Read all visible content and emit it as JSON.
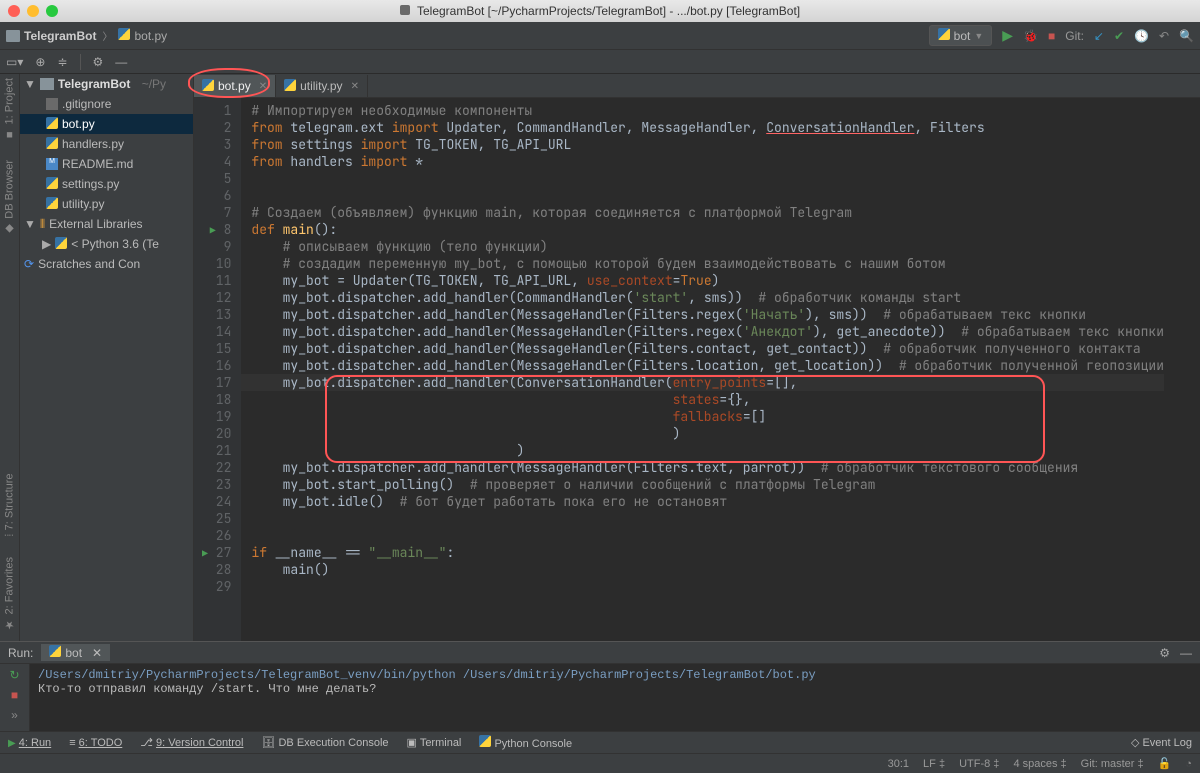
{
  "title": "TelegramBot [~/PycharmProjects/TelegramBot] - .../bot.py [TelegramBot]",
  "breadcrumbs": {
    "project": "TelegramBot",
    "file": "bot.py"
  },
  "run_config": {
    "name": "bot"
  },
  "git_label": "Git:",
  "tree": {
    "root": "TelegramBot",
    "root_path": "~/Py",
    "files": [
      ".gitignore",
      "bot.py",
      "handlers.py",
      "README.md",
      "settings.py",
      "utility.py"
    ],
    "selected": "bot.py",
    "ext_lib": "External Libraries",
    "python": "< Python 3.6 (Te",
    "scratches": "Scratches and Con"
  },
  "tabs": [
    {
      "name": "bot.py",
      "active": true
    },
    {
      "name": "utility.py",
      "active": false
    }
  ],
  "code": [
    {
      "n": 1,
      "t": "comment",
      "txt": "# Импортируем необходимые компоненты"
    },
    {
      "n": 2,
      "t": "import",
      "txt": "from telegram.ext import Updater, CommandHandler, MessageHandler, ConversationHandler, Filters",
      "red": "ConversationHandler"
    },
    {
      "n": 3,
      "t": "import",
      "txt": "from settings import TG_TOKEN, TG_API_URL"
    },
    {
      "n": 4,
      "t": "import",
      "txt": "from handlers import *"
    },
    {
      "n": 5,
      "t": "blank",
      "txt": ""
    },
    {
      "n": 6,
      "t": "blank",
      "txt": ""
    },
    {
      "n": 7,
      "t": "comment",
      "txt": "# Создаем (объявляем) функцию main, которая соединяется с платформой Telegram"
    },
    {
      "n": 8,
      "t": "def",
      "txt": "def main():"
    },
    {
      "n": 9,
      "t": "comment2",
      "txt": "    # описываем функцию (тело функции)"
    },
    {
      "n": 10,
      "t": "comment2",
      "txt": "    # создадим переменную my_bot, с помощью которой будем взаимодействовать с нашим ботом"
    },
    {
      "n": 11,
      "t": "code",
      "txt": "    my_bot = Updater(TG_TOKEN, TG_API_URL, use_context=True)"
    },
    {
      "n": 12,
      "t": "codec",
      "txt": "    my_bot.dispatcher.add_handler(CommandHandler('start', sms))  # обработчик команды start"
    },
    {
      "n": 13,
      "t": "codec",
      "txt": "    my_bot.dispatcher.add_handler(MessageHandler(Filters.regex('Начать'), sms))  # обрабатываем текс кнопки"
    },
    {
      "n": 14,
      "t": "codec",
      "txt": "    my_bot.dispatcher.add_handler(MessageHandler(Filters.regex('Анекдот'), get_anecdote))  # обрабатываем текс кнопки"
    },
    {
      "n": 15,
      "t": "codec",
      "txt": "    my_bot.dispatcher.add_handler(MessageHandler(Filters.contact, get_contact))  # обработчик полученного контакта"
    },
    {
      "n": 16,
      "t": "codec",
      "txt": "    my_bot.dispatcher.add_handler(MessageHandler(Filters.location, get_location))  # обработчик полученной геопозиции"
    },
    {
      "n": 17,
      "t": "code",
      "txt": "    my_bot.dispatcher.add_handler(ConversationHandler(entry_points=[],"
    },
    {
      "n": 18,
      "t": "code",
      "txt": "                                                      states={},"
    },
    {
      "n": 19,
      "t": "code",
      "txt": "                                                      fallbacks=[]"
    },
    {
      "n": 20,
      "t": "code",
      "txt": "                                                      )"
    },
    {
      "n": 21,
      "t": "code",
      "txt": "                                  )"
    },
    {
      "n": 22,
      "t": "codec",
      "txt": "    my_bot.dispatcher.add_handler(MessageHandler(Filters.text, parrot))  # обработчик текстового сообщения"
    },
    {
      "n": 23,
      "t": "codec",
      "txt": "    my_bot.start_polling()  # проверяет о наличии сообщений с платформы Telegram"
    },
    {
      "n": 24,
      "t": "codec",
      "txt": "    my_bot.idle()  # бот будет работать пока его не остановят"
    },
    {
      "n": 25,
      "t": "blank",
      "txt": ""
    },
    {
      "n": 26,
      "t": "blank",
      "txt": ""
    },
    {
      "n": 27,
      "t": "if",
      "txt": "if __name__ == \"__main__\":"
    },
    {
      "n": 28,
      "t": "code",
      "txt": "    main()"
    },
    {
      "n": 29,
      "t": "blank",
      "txt": ""
    }
  ],
  "run": {
    "label": "Run:",
    "tab": "bot",
    "out1": "/Users/dmitriy/PycharmProjects/TelegramBot_venv/bin/python /Users/dmitriy/PycharmProjects/TelegramBot/bot.py",
    "out2": "Кто-то отправил команду /start. Что мне делать?"
  },
  "bottom": {
    "run": "4: Run",
    "todo": "6: TODO",
    "vcs": "9: Version Control",
    "db": "DB Execution Console",
    "term": "Terminal",
    "pyc": "Python Console",
    "log": "Event Log"
  },
  "status": {
    "pos": "30:1",
    "le": "LF",
    "enc": "UTF-8",
    "ind": "4 spaces",
    "branch": "Git: master"
  },
  "side_labels": {
    "project": "1: Project",
    "db": "DB Browser",
    "structure": "7: Structure",
    "fav": "2: Favorites"
  }
}
